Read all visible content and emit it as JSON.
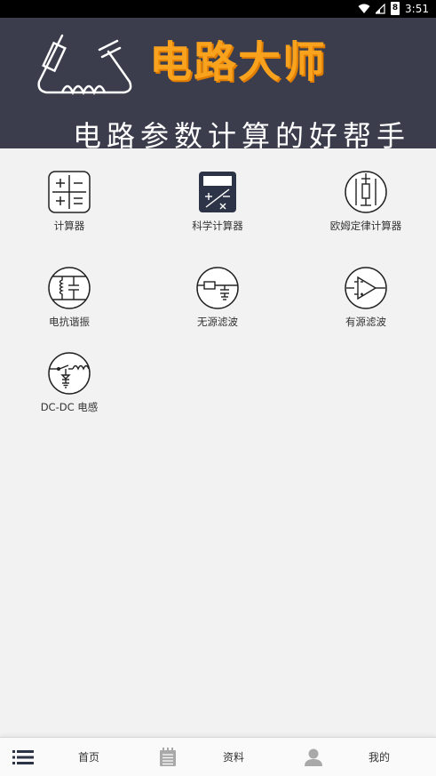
{
  "status_bar": {
    "time": "3:51",
    "battery": "8"
  },
  "banner": {
    "title": "电路大师",
    "subtitle": "电路参数计算的好帮手"
  },
  "tools": [
    {
      "label": "计算器",
      "icon": "calculator-icon"
    },
    {
      "label": "科学计算器",
      "icon": "scientific-calculator-icon"
    },
    {
      "label": "欧姆定律计算器",
      "icon": "ohms-law-icon"
    },
    {
      "label": "电抗谐振",
      "icon": "reactance-resonance-icon"
    },
    {
      "label": "无源滤波",
      "icon": "passive-filter-icon"
    },
    {
      "label": "有源滤波",
      "icon": "active-filter-icon"
    },
    {
      "label": "DC-DC 电感",
      "icon": "dc-dc-inductor-icon"
    }
  ],
  "bottom_nav": {
    "home_label": "首页",
    "resources_label": "资料",
    "mine_label": "我的"
  },
  "colors": {
    "banner_bg": "#3b3d4c",
    "title_orange": "#f8a21e"
  }
}
